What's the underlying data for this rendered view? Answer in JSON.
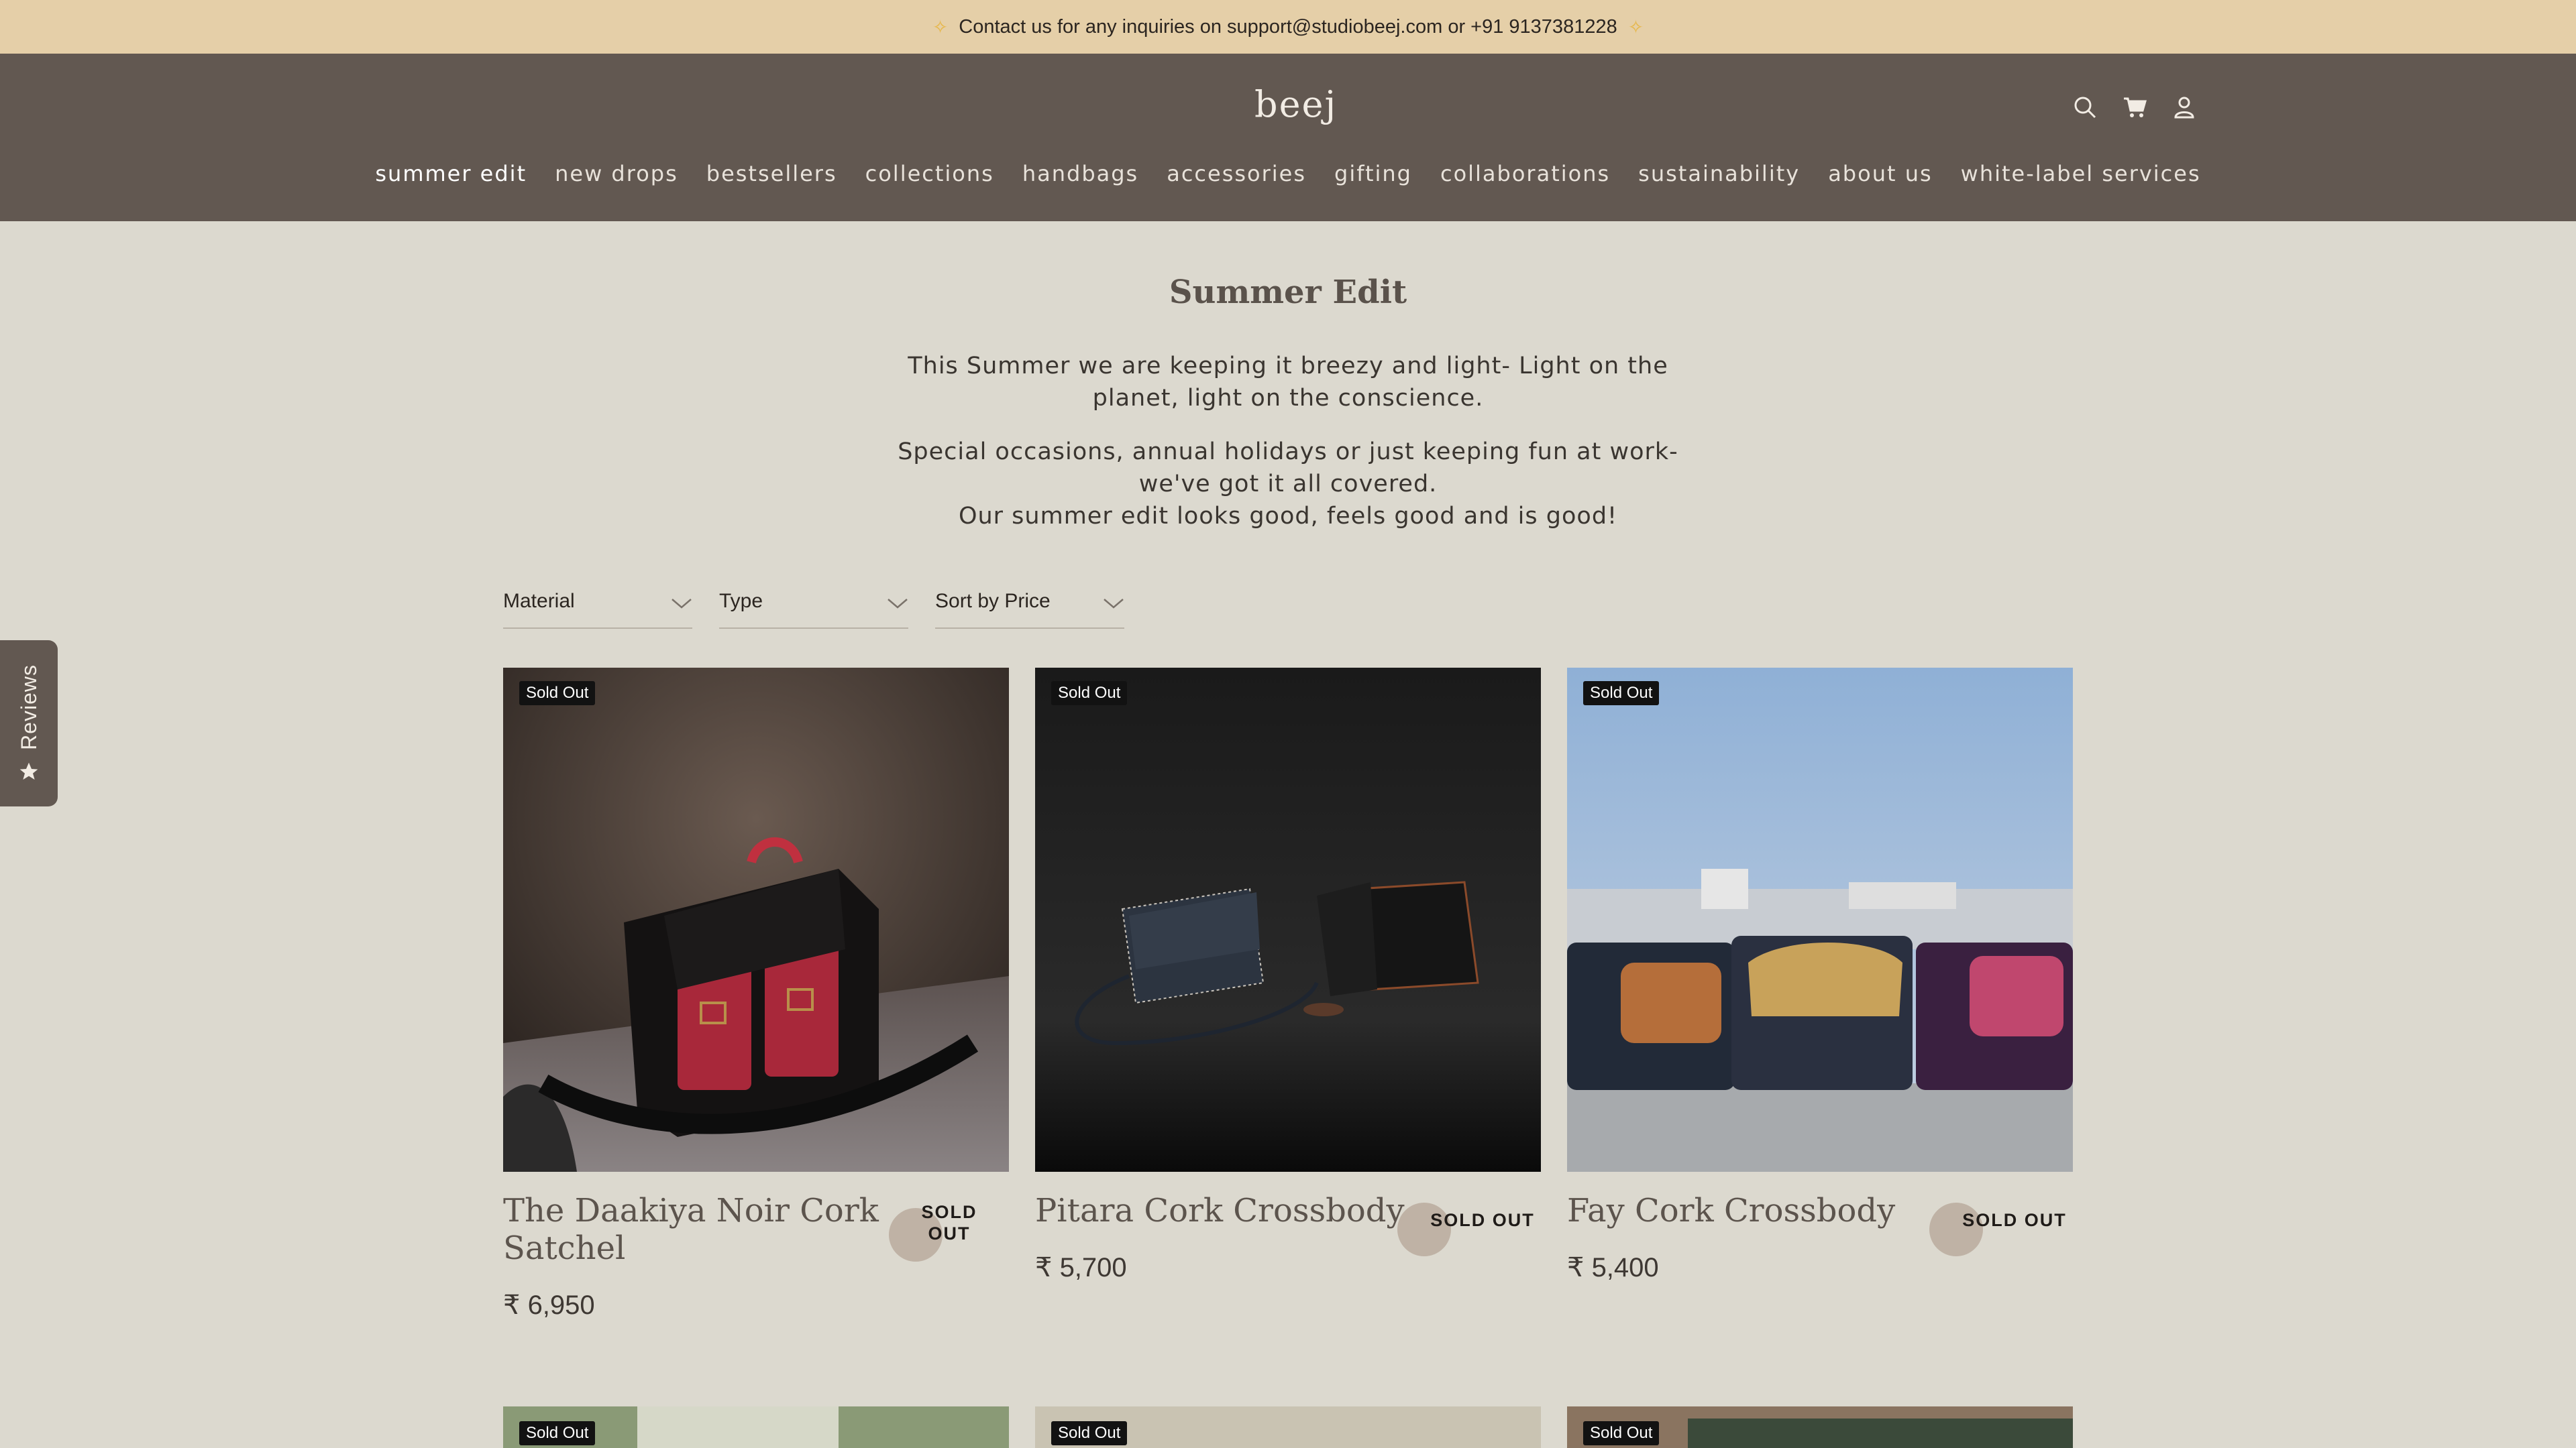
{
  "announcement": {
    "text": "Contact us for any inquiries on support@studiobeej.com or +91 9137381228"
  },
  "header": {
    "logo": "beej",
    "icons": [
      "search-icon",
      "cart-icon",
      "account-icon"
    ],
    "nav": [
      {
        "label": "summer edit",
        "active": true
      },
      {
        "label": "new drops"
      },
      {
        "label": "bestsellers"
      },
      {
        "label": "collections"
      },
      {
        "label": "handbags"
      },
      {
        "label": "accessories"
      },
      {
        "label": "gifting"
      },
      {
        "label": "collaborations"
      },
      {
        "label": "sustainability"
      },
      {
        "label": "about us"
      },
      {
        "label": "white-label services"
      }
    ]
  },
  "page": {
    "title": "Summer Edit",
    "intro_1": "This Summer we are keeping it breezy and light- Light on the planet, light on the conscience.",
    "intro_2a": "Special occasions, annual holidays or just keeping fun at work- we've got it all covered.",
    "intro_2b": "Our summer edit looks good, feels good and is good!"
  },
  "filters": {
    "material": "Material",
    "type": "Type",
    "sort": "Sort by Price"
  },
  "reviews_tab": {
    "label": "Reviews"
  },
  "products": [
    {
      "title": "The Daakiya Noir Cork Satchel",
      "price": "₹ 6,950",
      "badge": "Sold Out",
      "sold_label": "SOLD OUT"
    },
    {
      "title": "Pitara Cork Crossbody",
      "price": "₹ 5,700",
      "badge": "Sold Out",
      "sold_label": "SOLD OUT"
    },
    {
      "title": "Fay Cork Crossbody",
      "price": "₹ 5,400",
      "badge": "Sold Out",
      "sold_label": "SOLD OUT"
    }
  ],
  "next_row_badges": [
    "Sold Out",
    "Sold Out",
    "Sold Out"
  ],
  "colors": {
    "announcement_bg": "#e5cfa8",
    "header_bg": "#625851",
    "page_bg": "#dcd9cf",
    "badge_bg": "#121212",
    "sold_dot": "#bfb2a5"
  }
}
